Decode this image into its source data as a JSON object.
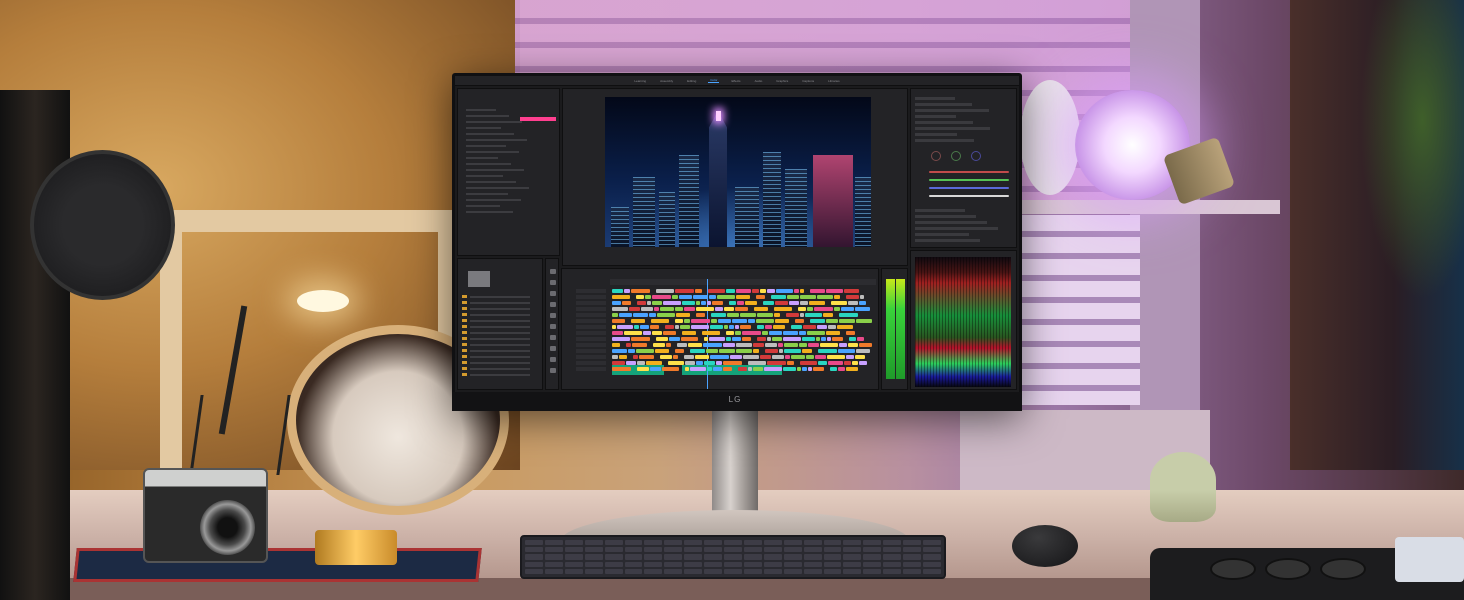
{
  "scene": {
    "monitor": {
      "brand": "LG"
    },
    "app": {
      "workspaces": [
        "Learning",
        "Assembly",
        "Editing",
        "Color",
        "Effects",
        "Audio",
        "Graphics",
        "Captions",
        "Libraries"
      ],
      "active_workspace": 3
    },
    "colors": {
      "accent": "#4aa3ff",
      "timeline_pink": "#ff3f8f",
      "audio_green": "#15a37a"
    }
  }
}
